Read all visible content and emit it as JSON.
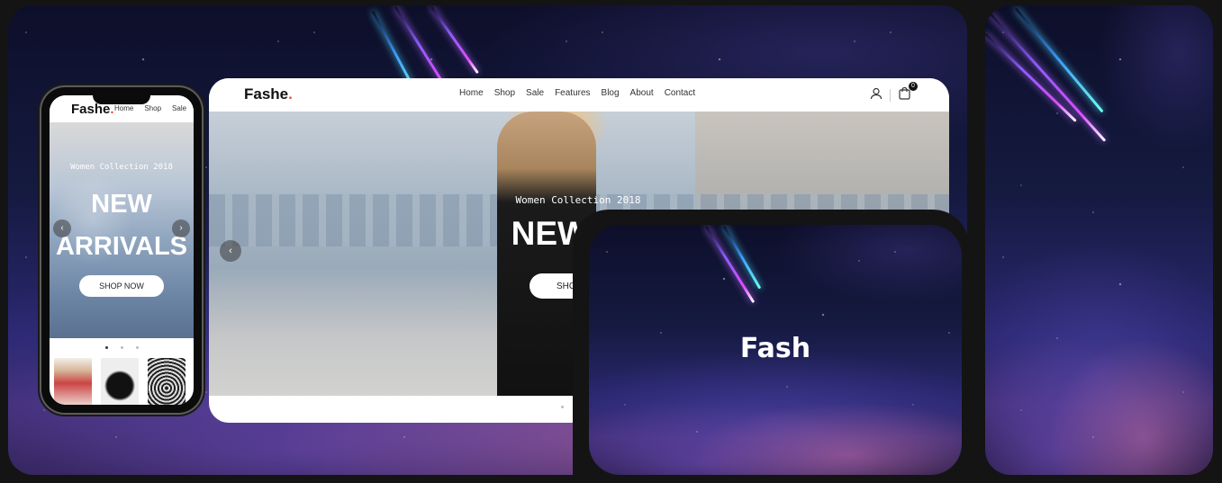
{
  "desktop": {
    "logo": "Fashe",
    "logo_dot": ".",
    "nav": [
      "Home",
      "Shop",
      "Sale",
      "Features",
      "Blog",
      "About",
      "Contact"
    ],
    "cart_count": "0",
    "hero": {
      "subtitle": "Women Collection 2018",
      "title": "NEW AR",
      "button": "SHO",
      "prev_arrow": "‹"
    }
  },
  "mobile": {
    "logo": "Fashe",
    "logo_dot": ".",
    "nav": [
      "Home",
      "Shop",
      "Sale"
    ],
    "hero": {
      "subtitle": "Women Collection 2018",
      "title_line1": "NEW",
      "title_line2": "ARRIVALS",
      "button": "SHOP NOW",
      "prev_arrow": "‹",
      "next_arrow": "›"
    }
  },
  "overlay_card": {
    "title": "Fash"
  },
  "colors": {
    "accent": "#e74c3c",
    "background": "#141414"
  }
}
